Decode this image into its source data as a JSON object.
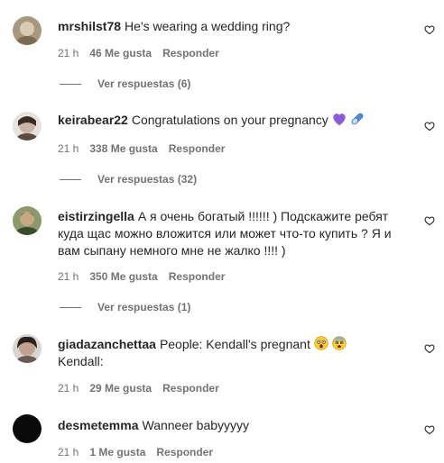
{
  "comments": [
    {
      "username": "mrshilst78",
      "text": "He's wearing a wedding ring?",
      "time": "21 h",
      "likes": "46 Me gusta",
      "reply": "Responder",
      "replies": "Ver respuestas (6)"
    },
    {
      "username": "keirabear22",
      "text": "Congratulations on your pregnancy",
      "emoji_icons": [
        "purple-heart-icon",
        "pill-icon"
      ],
      "time": "21 h",
      "likes": "338 Me gusta",
      "reply": "Responder",
      "replies": "Ver respuestas (32)"
    },
    {
      "username": "eistirzingella",
      "text_line1": "А я очень богатый !!!!!! ) Подскажите ребят",
      "text_line2": "куда щас можно вложится или может что-то купить ? Я и",
      "text_line3": "вам сыпану немного мне не жалко !!!! )",
      "time": "21 h",
      "likes": "350 Me gusta",
      "reply": "Responder",
      "replies": "Ver respuestas (1)"
    },
    {
      "username": "giadazanchettaa",
      "text_line1": "People: Kendall's pregnant",
      "emoji_icons": [
        "shocked-face-icon",
        "fearful-face-icon"
      ],
      "text_line2": "Kendall:",
      "time": "21 h",
      "likes": "29 Me gusta",
      "reply": "Responder"
    },
    {
      "username": "desmetemma",
      "text": "Wanneer babyyyyy",
      "time": "21 h",
      "likes": "1 Me gusta",
      "reply": "Responder"
    }
  ],
  "colors": {
    "text": "#262626",
    "secondary": "#737373",
    "purple_heart": "#8e5bd6",
    "pill": "#4a8ee0"
  }
}
